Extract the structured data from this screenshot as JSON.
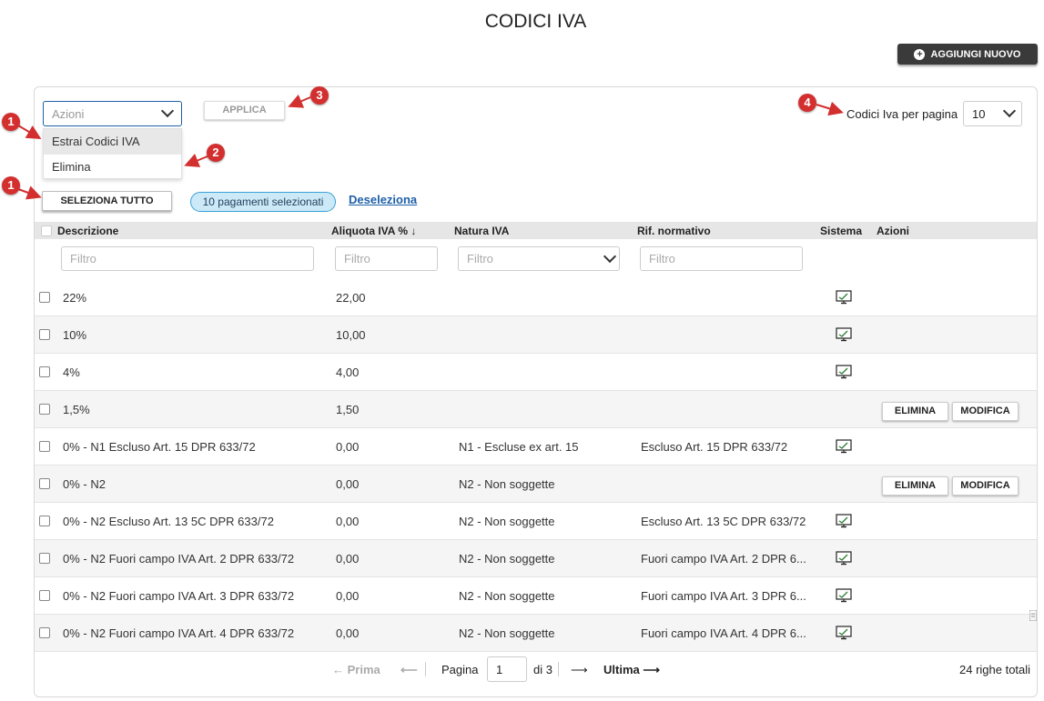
{
  "page": {
    "title": "CODICI IVA"
  },
  "header": {
    "add_button_label": "AGGIUNGI NUOVO"
  },
  "toolbar": {
    "actions_placeholder": "Azioni",
    "actions_options": [
      "Estrai Codici IVA",
      "Elimina"
    ],
    "apply_label": "APPLICA",
    "per_page_label": "Codici Iva per pagina",
    "per_page_value": "10",
    "select_all_label": "SELEZIONA TUTTO",
    "selected_badge": "10 pagamenti selezionati",
    "deselect_label": "Deseleziona"
  },
  "annotations": [
    "1",
    "2",
    "3",
    "4",
    "1"
  ],
  "table": {
    "columns": [
      "Descrizione",
      "Aliquota IVA %",
      "Natura IVA",
      "Rif. normativo",
      "Sistema",
      "Azioni"
    ],
    "sort_indicator": "↓",
    "filter_placeholder": "Filtro",
    "rows": [
      {
        "descrizione": "22%",
        "aliquota": "22,00",
        "natura": "",
        "rif": "",
        "sistema": true,
        "actions": false
      },
      {
        "descrizione": "10%",
        "aliquota": "10,00",
        "natura": "",
        "rif": "",
        "sistema": true,
        "actions": false
      },
      {
        "descrizione": "4%",
        "aliquota": "4,00",
        "natura": "",
        "rif": "",
        "sistema": true,
        "actions": false
      },
      {
        "descrizione": "1,5%",
        "aliquota": "1,50",
        "natura": "",
        "rif": "",
        "sistema": false,
        "actions": true
      },
      {
        "descrizione": "0% - N1 Escluso Art. 15 DPR 633/72",
        "aliquota": "0,00",
        "natura": "N1 - Escluse ex art. 15",
        "rif": "Escluso Art. 15 DPR 633/72",
        "sistema": true,
        "actions": false
      },
      {
        "descrizione": "0% - N2",
        "aliquota": "0,00",
        "natura": "N2 - Non soggette",
        "rif": "",
        "sistema": false,
        "actions": true
      },
      {
        "descrizione": "0% - N2 Escluso Art. 13 5C DPR 633/72",
        "aliquota": "0,00",
        "natura": "N2 - Non soggette",
        "rif": "Escluso Art. 13 5C DPR 633/72",
        "sistema": true,
        "actions": false
      },
      {
        "descrizione": "0% - N2 Fuori campo IVA Art. 2 DPR 633/72",
        "aliquota": "0,00",
        "natura": "N2 - Non soggette",
        "rif": "Fuori campo IVA Art. 2 DPR 6...",
        "sistema": true,
        "actions": false
      },
      {
        "descrizione": "0% - N2 Fuori campo IVA Art. 3 DPR 633/72",
        "aliquota": "0,00",
        "natura": "N2 - Non soggette",
        "rif": "Fuori campo IVA Art. 3 DPR 6...",
        "sistema": true,
        "actions": false
      },
      {
        "descrizione": "0% - N2 Fuori campo IVA Art. 4 DPR 633/72",
        "aliquota": "0,00",
        "natura": "N2 - Non soggette",
        "rif": "Fuori campo IVA Art. 4 DPR 6...",
        "sistema": true,
        "actions": false
      }
    ],
    "row_delete_label": "ELIMINA",
    "row_edit_label": "MODIFICA"
  },
  "pagination": {
    "first_label": "← Prima",
    "prev_label": "⟵",
    "page_label": "Pagina",
    "page_value": "1",
    "of_label": "di 3",
    "next_label": "⟶",
    "last_label": "Ultima ⟶",
    "total_label": "24 righe totali"
  },
  "colors": {
    "accent": "#1e5fa8",
    "marker": "#d32f2f",
    "badge_bg": "#cce9f7",
    "header_bg": "#e6e6e6"
  }
}
